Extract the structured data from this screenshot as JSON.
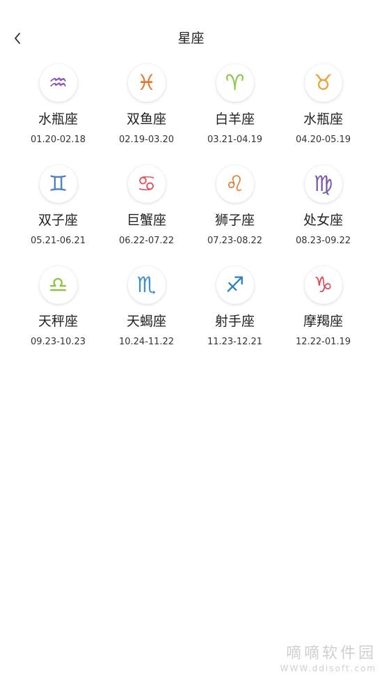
{
  "header": {
    "title": "星座",
    "back_icon": "chevron-left-icon"
  },
  "signs": [
    {
      "name": "水瓶座",
      "dates": "01.20-02.18",
      "glyph": "♒",
      "color": "#8a56b8"
    },
    {
      "name": "双鱼座",
      "dates": "02.19-03.20",
      "glyph": "♓",
      "color": "#e4752c"
    },
    {
      "name": "白羊座",
      "dates": "03.21-04.19",
      "glyph": "♈",
      "color": "#8cc63f"
    },
    {
      "name": "水瓶座",
      "dates": "04.20-05.19",
      "glyph": "♉",
      "color": "#e9a33a"
    },
    {
      "name": "双子座",
      "dates": "05.21-06.21",
      "glyph": "♊",
      "color": "#4a7fc4"
    },
    {
      "name": "巨蟹座",
      "dates": "06.22-07.22",
      "glyph": "♋",
      "color": "#e0575f"
    },
    {
      "name": "狮子座",
      "dates": "07.23-08.22",
      "glyph": "♌",
      "color": "#e0782b"
    },
    {
      "name": "处女座",
      "dates": "08.23-09.22",
      "glyph": "♍",
      "color": "#7b56b0"
    },
    {
      "name": "天秤座",
      "dates": "09.23-10.23",
      "glyph": "♎",
      "color": "#8cc63f"
    },
    {
      "name": "天蝎座",
      "dates": "10.24-11.22",
      "glyph": "♏",
      "color": "#3a8fd0"
    },
    {
      "name": "射手座",
      "dates": "11.23-12.21",
      "glyph": "♐",
      "color": "#2f7fc0"
    },
    {
      "name": "摩羯座",
      "dates": "12.22-01.19",
      "glyph": "♑",
      "color": "#e24c5a"
    }
  ],
  "watermark": {
    "title": "嘀嘀软件园",
    "url": "WWW.ddisoft.com"
  }
}
